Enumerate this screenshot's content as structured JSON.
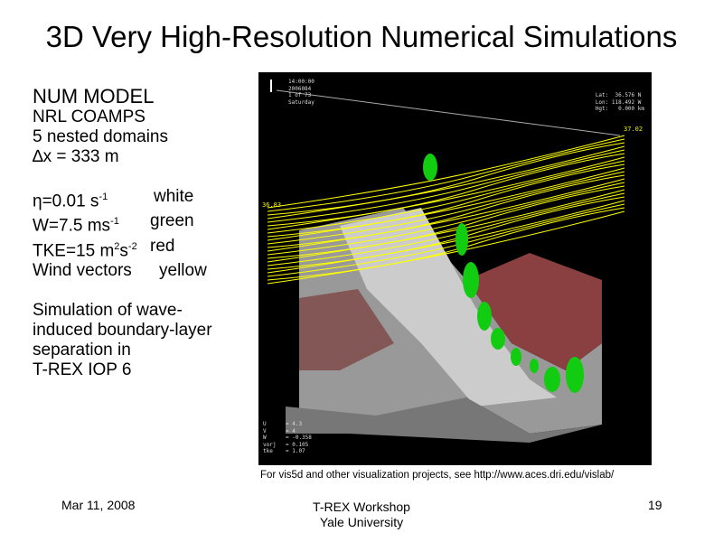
{
  "title": "3D Very High-Resolution Numerical Simulations",
  "left": {
    "heading": "NUM MODEL",
    "lines": [
      "NRL COAMPS",
      "5 nested domains",
      "∆x = 333 m"
    ],
    "legend": [
      {
        "pre": "η=0.01 s",
        "sup": "-1",
        "post": "",
        "color": "white"
      },
      {
        "pre": "W=7.5 ms",
        "sup": "-1",
        "post": "",
        "color": "green"
      },
      {
        "pre": "TKE=15 m",
        "sup": "2",
        "post": "s",
        "sup2": "-2",
        "color": "red"
      },
      {
        "pre": "Wind vectors",
        "sup": "",
        "post": "",
        "color": "yellow"
      }
    ],
    "description": [
      "Simulation of wave-",
      "induced boundary-layer",
      "separation in",
      "T-REX IOP 6"
    ]
  },
  "sim": {
    "time": "14:00:00",
    "date": "2006084",
    "frame": "1 of 73",
    "day": "Saturday",
    "lat": "Lat:  36.576 N",
    "lon": "Lon: 118.492 W",
    "hgt": "Hgt:   0.000 km",
    "label_right": "37.02",
    "label_left": "36.83",
    "readouts": [
      [
        "U",
        "= 4.3"
      ],
      [
        "V",
        "= 4"
      ],
      [
        "W",
        "= -0.358"
      ],
      [
        "vorj",
        "= 0.105"
      ],
      [
        "tke",
        "= 1.07"
      ]
    ]
  },
  "caption": "For vis5d and other visualization projects, see http://www.aces.dri.edu/vislab/",
  "footer": {
    "date": "Mar 11, 2008",
    "center1": "T-REX Workshop",
    "center2": "Yale University",
    "page": "19"
  }
}
